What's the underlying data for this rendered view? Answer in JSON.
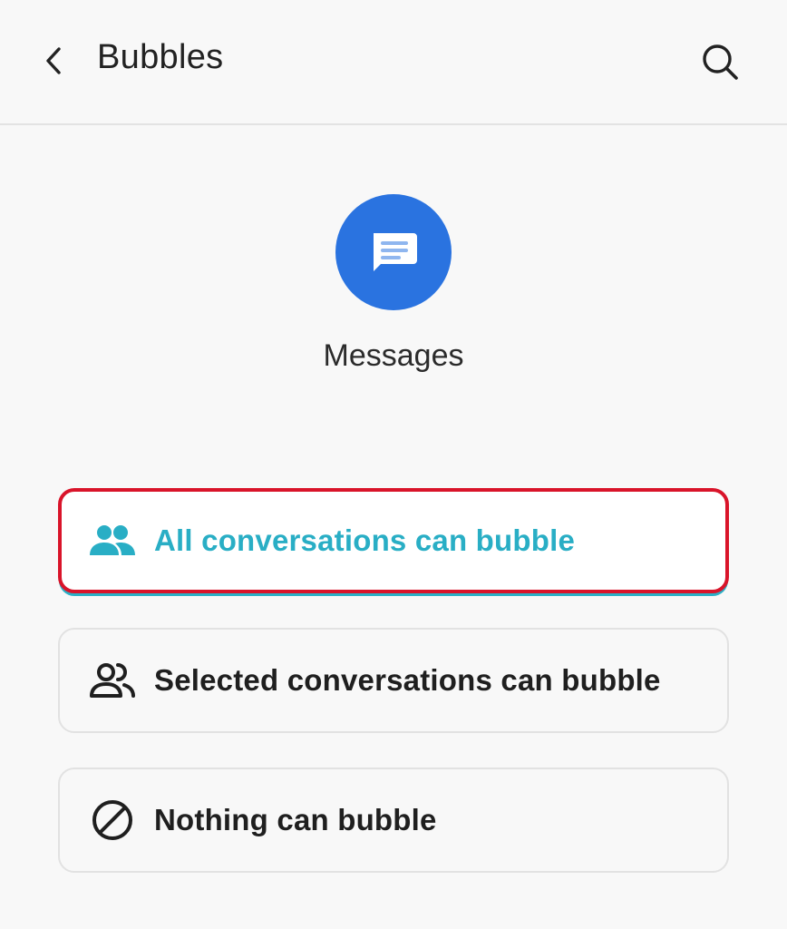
{
  "header": {
    "title": "Bubbles",
    "back_icon": "chevron-left-icon",
    "search_icon": "search-icon"
  },
  "app": {
    "name": "Messages",
    "icon": "messages-app-icon",
    "icon_color": "#2a73e0"
  },
  "options": [
    {
      "label": "All conversations can bubble",
      "icon": "people-icon",
      "selected": true
    },
    {
      "label": "Selected conversations can bubble",
      "icon": "people-outline-icon",
      "selected": false
    },
    {
      "label": "Nothing can bubble",
      "icon": "block-icon",
      "selected": false
    }
  ],
  "colors": {
    "accent": "#29aec5",
    "highlight_border": "#d9142a"
  }
}
